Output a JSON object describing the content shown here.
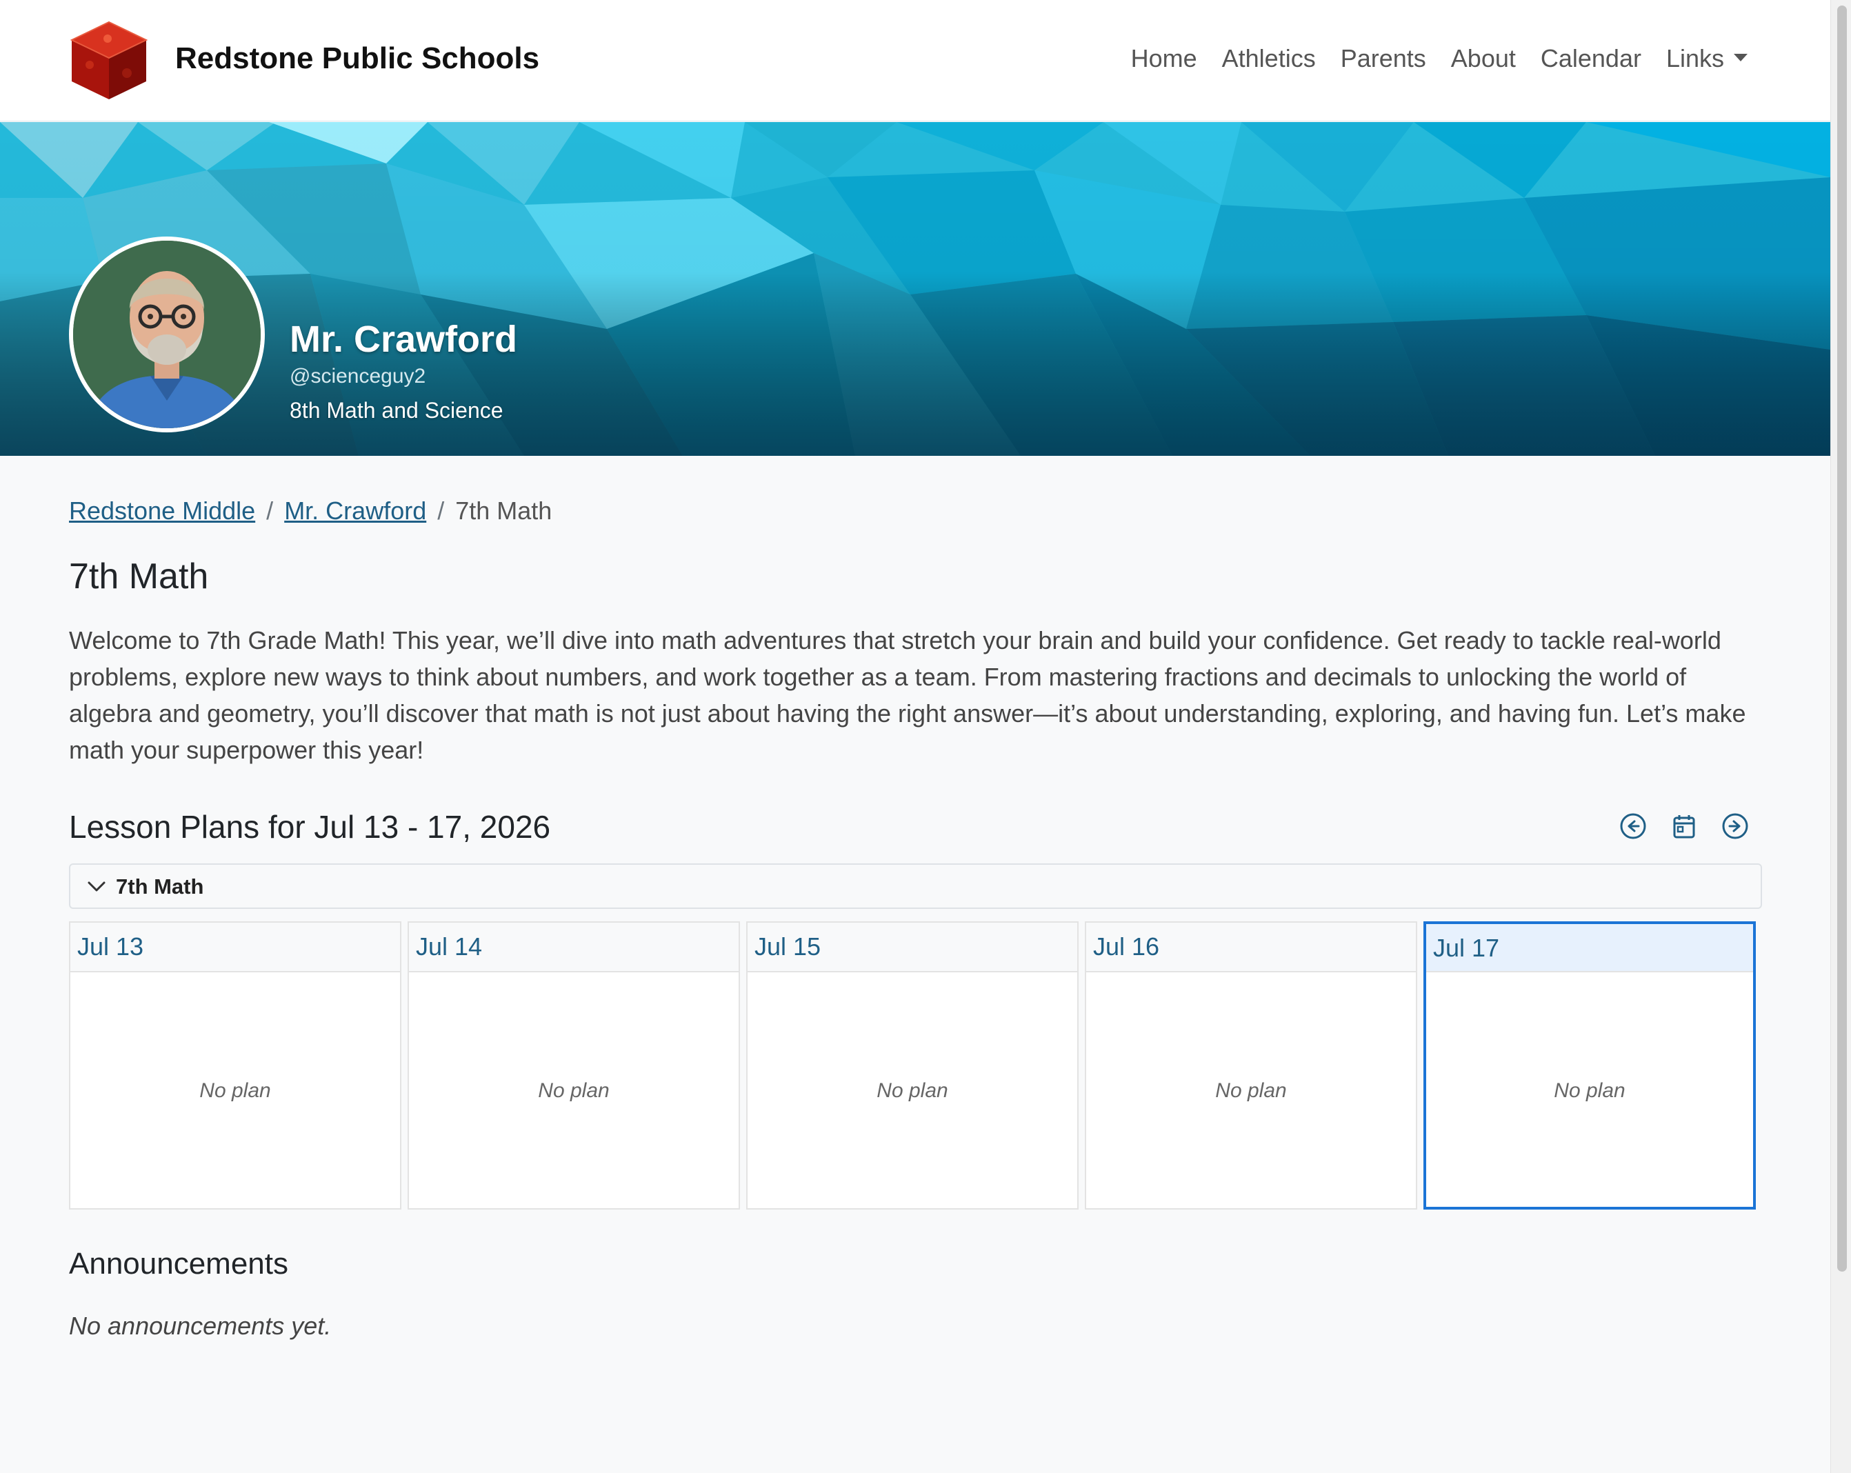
{
  "site": {
    "brand": "Redstone Public Schools",
    "nav": [
      "Home",
      "Athletics",
      "Parents",
      "About",
      "Calendar"
    ],
    "links_label": "Links"
  },
  "teacher": {
    "name": "Mr. Crawford",
    "handle": "@scienceguy2",
    "role": "8th Math and Science"
  },
  "breadcrumb": {
    "school": "Redstone Middle",
    "teacher": "Mr. Crawford",
    "current": "7th Math"
  },
  "page": {
    "title": "7th Math",
    "intro": "Welcome to 7th Grade Math! This year, we’ll dive into math adventures that stretch your brain and build your confidence. Get ready to tackle real-world problems, explore new ways to think about numbers, and work together as a team. From mastering fractions and decimals to unlocking the world of algebra and geometry, you’ll discover that math is not just about having the right answer—it’s about understanding, exploring, and having fun. Let’s make math your superpower this year!"
  },
  "lesson_plans": {
    "title": "Lesson Plans for Jul 13 - 17, 2026",
    "section": "7th Math",
    "days": [
      {
        "date": "Jul 13",
        "plan": "No plan"
      },
      {
        "date": "Jul 14",
        "plan": "No plan"
      },
      {
        "date": "Jul 15",
        "plan": "No plan"
      },
      {
        "date": "Jul 16",
        "plan": "No plan"
      },
      {
        "date": "Jul 17",
        "plan": "No plan",
        "today": true
      }
    ]
  },
  "announcements": {
    "title": "Announcements",
    "empty": "No announcements yet."
  },
  "colors": {
    "link": "#1f5f86",
    "today_border": "#1b74d6",
    "logo_red": "#b3160f",
    "banner_cyan": "#22b8d9"
  }
}
